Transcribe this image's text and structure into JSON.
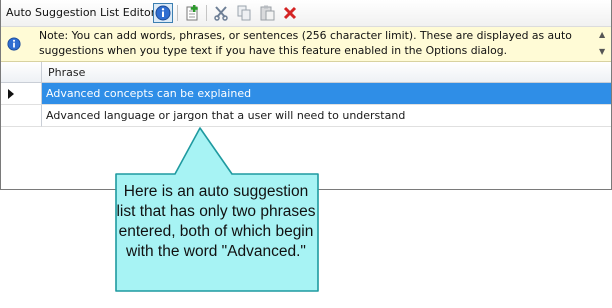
{
  "toolbar": {
    "title": "Auto Suggestion List Editor",
    "icons": [
      "info-icon",
      "add-icon",
      "cut-icon",
      "copy-icon",
      "paste-icon",
      "delete-icon"
    ]
  },
  "note": {
    "text": "Note: You can add words, phrases, or sentences (256 character limit). These are displayed as auto suggestions when you type text if you have this feature enabled in the Options dialog."
  },
  "grid": {
    "column_header": "Phrase",
    "rows": [
      {
        "phrase": "Advanced concepts can be explained",
        "selected": true
      },
      {
        "phrase": "Advanced language or jargon that a user will need to understand",
        "selected": false
      }
    ]
  },
  "callout": {
    "text": "Here is an auto suggestion list that has only two phrases entered, both of which begin with the word \"Advanced.\""
  },
  "colors": {
    "selection": "#2f8ee7",
    "note_background": "#fffbd6",
    "callout_fill": "#a7f3f4",
    "callout_border": "#1f9aa0"
  }
}
